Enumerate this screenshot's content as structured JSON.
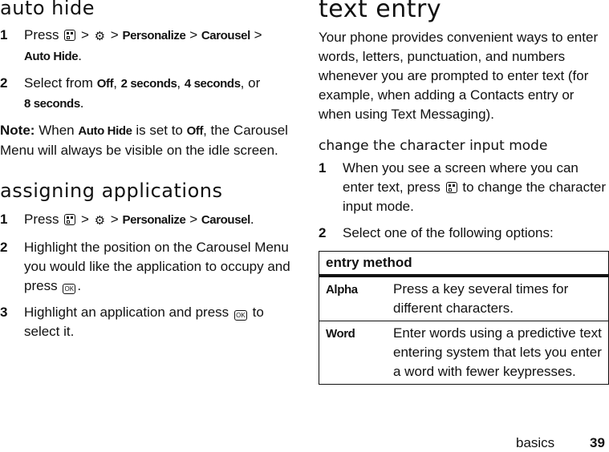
{
  "left": {
    "auto_hide": {
      "title": "auto hide",
      "steps": [
        {
          "num": "1",
          "parts": [
            "Press",
            "menu-key-icon",
            ">",
            "settings-icon",
            ">",
            "Personalize",
            ">",
            "Carousel",
            ">",
            "Auto Hide",
            "."
          ]
        },
        {
          "num": "2",
          "text_prefix": "Select from",
          "options": [
            "Off",
            "2 seconds",
            "4 seconds",
            "8 seconds"
          ],
          "joiner": "or"
        }
      ],
      "note": {
        "label": "Note:",
        "text_a": "When",
        "key_a": "Auto Hide",
        "text_b": "is set to",
        "key_b": "Off",
        "text_c": ", the Carousel Menu will always be visible on the idle screen."
      }
    },
    "assigning": {
      "title": "assigning applications",
      "steps": [
        {
          "num": "1",
          "press": "Press",
          "sep": ">",
          "path": [
            "Personalize",
            "Carousel"
          ]
        },
        {
          "num": "2",
          "text": "Highlight the position on the Carousel Menu you would like the application to occupy and press",
          "end": "."
        },
        {
          "num": "3",
          "text": "Highlight an application and press",
          "end": "to select it."
        }
      ]
    }
  },
  "right": {
    "title": "text entry",
    "intro": "Your phone provides convenient ways to enter words, letters, punctuation, and numbers whenever you are prompted to enter text (for example, when adding a Contacts entry or when using Text Messaging).",
    "subtitle": "change the character input mode",
    "steps": [
      {
        "num": "1",
        "text_a": "When you see a screen where you can enter text, press",
        "text_b": "to change the character input mode."
      },
      {
        "num": "2",
        "text": "Select one of the following options:"
      }
    ],
    "table": {
      "header": "entry method",
      "rows": [
        {
          "name": "Alpha",
          "desc": "Press a key several times for different characters."
        },
        {
          "name": "Word",
          "desc": "Enter words using a predictive text entering system that lets you enter a word with fewer keypresses."
        }
      ]
    }
  },
  "icons": {
    "ok_label": "OK",
    "settings_glyph": "⚙"
  },
  "footer": {
    "section": "basics",
    "page": "39"
  }
}
